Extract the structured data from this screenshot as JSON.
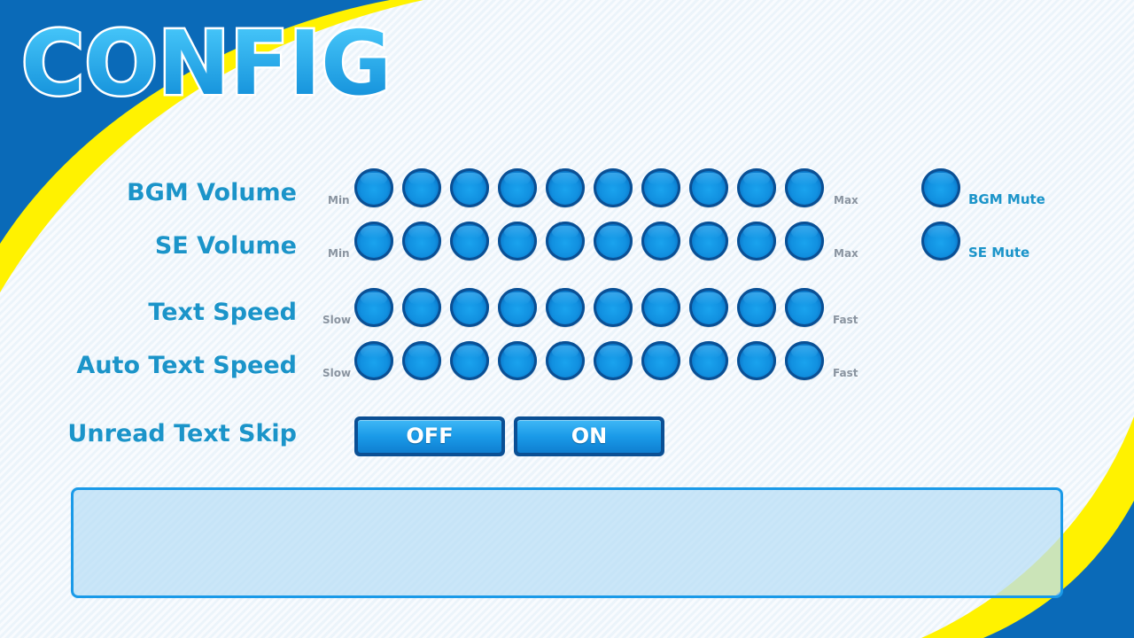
{
  "header": {
    "title": "CONFIG"
  },
  "colors": {
    "dark_blue": "#0a6ab8",
    "yellow": "#fff200",
    "accent": "#1a9ae8",
    "label": "#1b94c9"
  },
  "settings": [
    {
      "label": "BGM Volume",
      "min_label": "Min",
      "max_label": "Max",
      "steps": 10
    },
    {
      "label": "SE Volume",
      "min_label": "Min",
      "max_label": "Max",
      "steps": 10
    },
    {
      "label": "Text Speed",
      "min_label": "Slow",
      "max_label": "Fast",
      "steps": 10
    },
    {
      "label": "Auto Text Speed",
      "min_label": "Slow",
      "max_label": "Fast",
      "steps": 10
    }
  ],
  "mutes": [
    {
      "label": "BGM Mute"
    },
    {
      "label": "SE Mute"
    }
  ],
  "skip": {
    "label": "Unread Text Skip",
    "off_label": "OFF",
    "on_label": "ON"
  },
  "info_panel": {
    "text": ""
  }
}
